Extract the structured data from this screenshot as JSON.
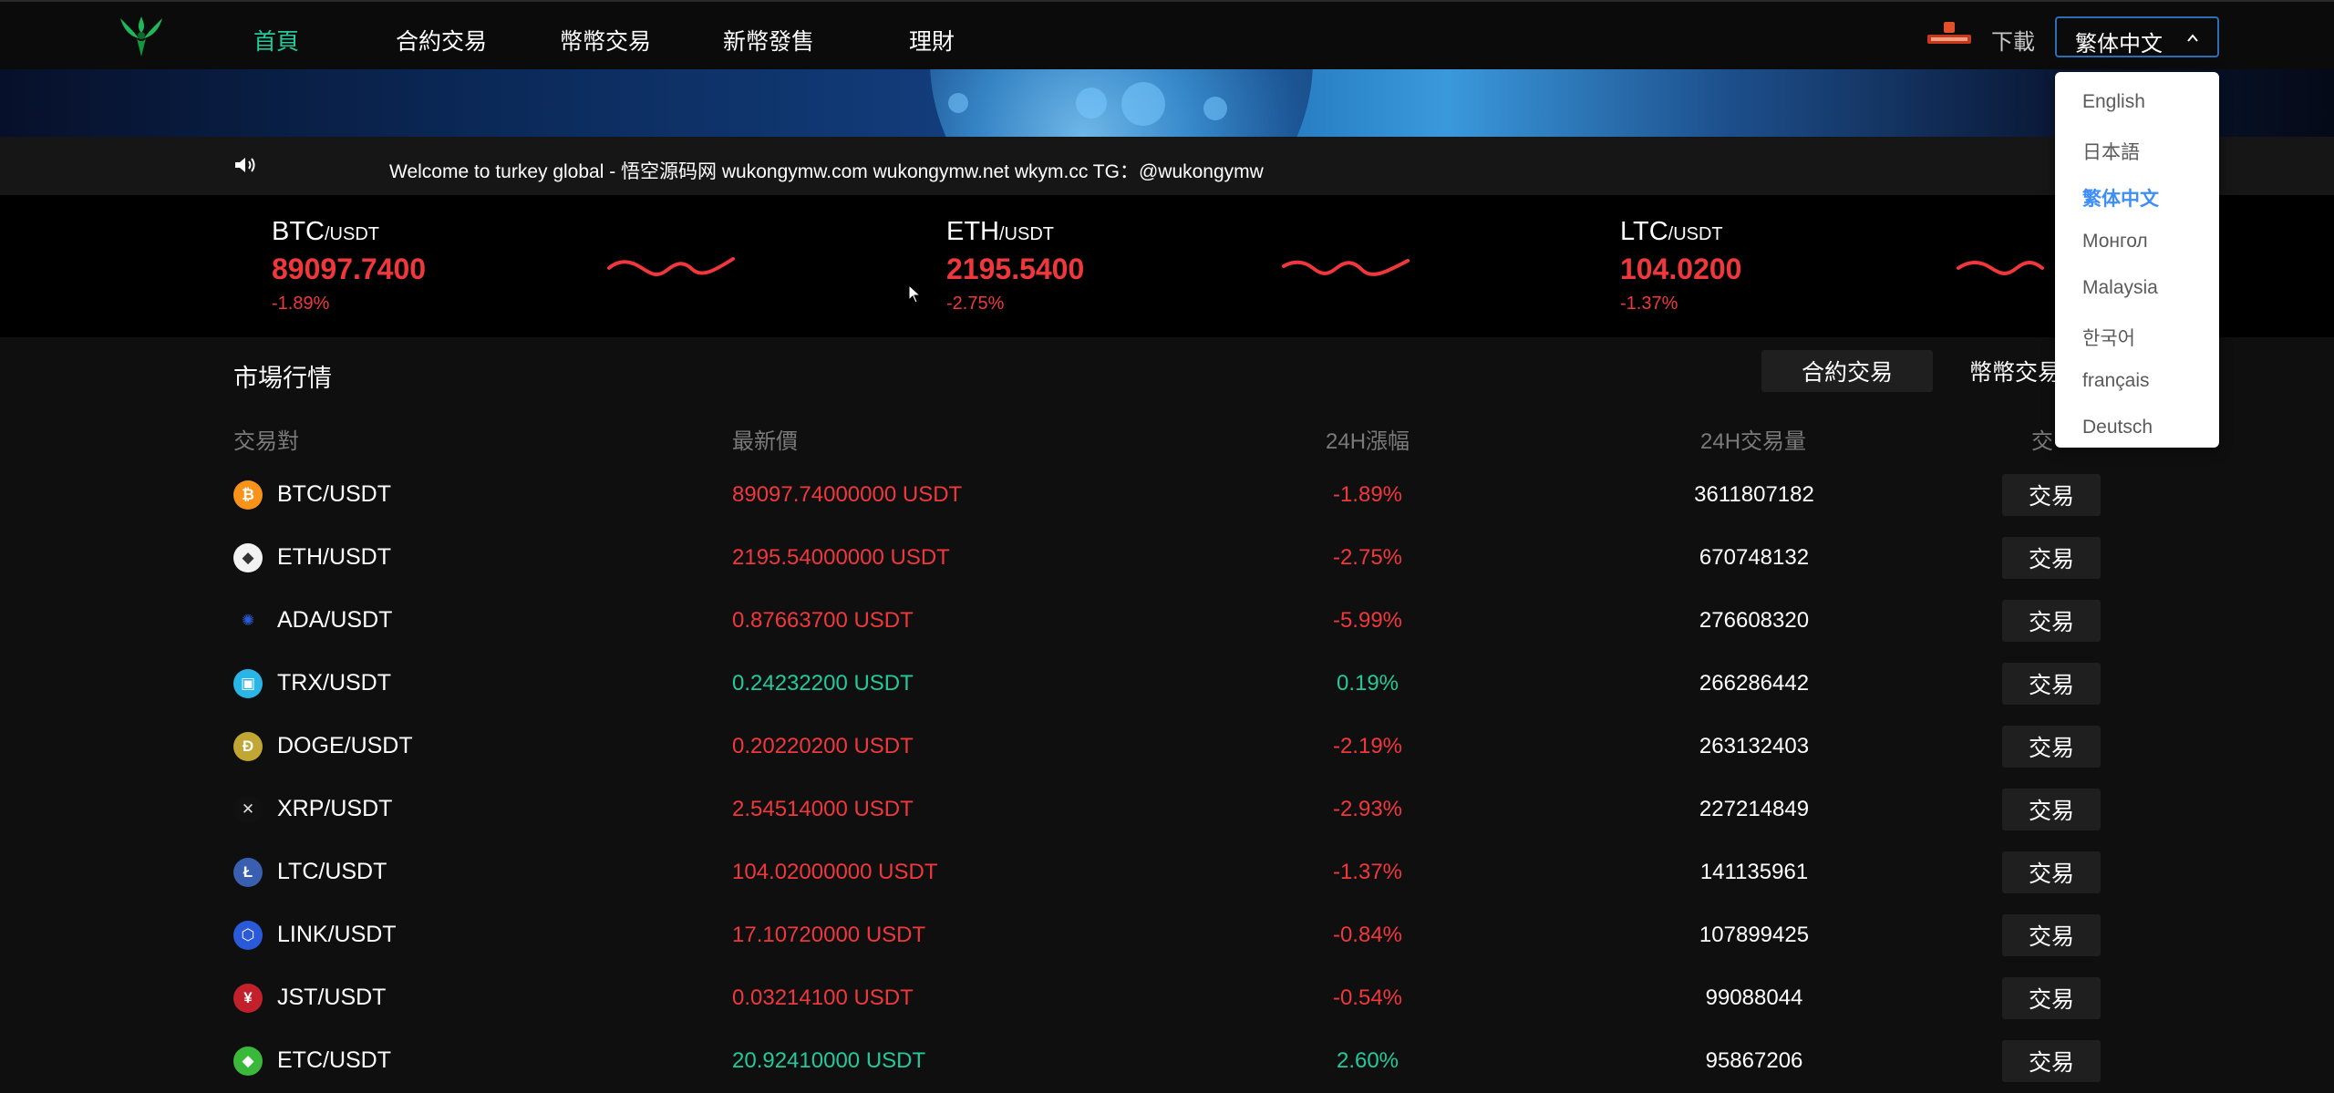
{
  "header": {
    "nav": [
      "首頁",
      "合約交易",
      "幣幣交易",
      "新幣發售",
      "理財"
    ],
    "download_label": "下載",
    "language_value": "繁体中文",
    "icons": {
      "logo": "phoenix-logo",
      "promo": "promo-badge-icon",
      "chevron": "chevron-up-icon"
    },
    "accent_color": "#23c99a"
  },
  "notice": {
    "icon": "speaker-icon",
    "text": "Welcome to turkey global - 悟空源码网 wukongymw.com wukongymw.net wkym.cc TG：@wukongymw"
  },
  "tickers": [
    {
      "base": "BTC",
      "quote": "/USDT",
      "price": "89097.7400",
      "change": "-1.89%"
    },
    {
      "base": "ETH",
      "quote": "/USDT",
      "price": "2195.5400",
      "change": "-2.75%"
    },
    {
      "base": "LTC",
      "quote": "/USDT",
      "price": "104.0200",
      "change": "-1.37%"
    }
  ],
  "market": {
    "title": "市場行情",
    "tabs": [
      "合約交易",
      "幣幣交易"
    ],
    "columns": [
      "交易對",
      "最新價",
      "24H漲幅",
      "24H交易量",
      "交"
    ],
    "trade_label": "交易",
    "rows": [
      {
        "pair": "BTC/USDT",
        "price": "89097.74000000 USDT",
        "change": "-1.89%",
        "volume": "3611807182",
        "dir": "down",
        "icon": "btc-icon"
      },
      {
        "pair": "ETH/USDT",
        "price": "2195.54000000 USDT",
        "change": "-2.75%",
        "volume": "670748132",
        "dir": "down",
        "icon": "eth-icon"
      },
      {
        "pair": "ADA/USDT",
        "price": "0.87663700 USDT",
        "change": "-5.99%",
        "volume": "276608320",
        "dir": "down",
        "icon": "ada-icon"
      },
      {
        "pair": "TRX/USDT",
        "price": "0.24232200 USDT",
        "change": "0.19%",
        "volume": "266286442",
        "dir": "up",
        "icon": "trx-icon"
      },
      {
        "pair": "DOGE/USDT",
        "price": "0.20220200 USDT",
        "change": "-2.19%",
        "volume": "263132403",
        "dir": "down",
        "icon": "doge-icon"
      },
      {
        "pair": "XRP/USDT",
        "price": "2.54514000 USDT",
        "change": "-2.93%",
        "volume": "227214849",
        "dir": "down",
        "icon": "xrp-icon"
      },
      {
        "pair": "LTC/USDT",
        "price": "104.02000000 USDT",
        "change": "-1.37%",
        "volume": "141135961",
        "dir": "down",
        "icon": "ltc-icon"
      },
      {
        "pair": "LINK/USDT",
        "price": "17.10720000 USDT",
        "change": "-0.84%",
        "volume": "107899425",
        "dir": "down",
        "icon": "link-icon"
      },
      {
        "pair": "JST/USDT",
        "price": "0.03214100 USDT",
        "change": "-0.54%",
        "volume": "99088044",
        "dir": "down",
        "icon": "jst-icon"
      },
      {
        "pair": "ETC/USDT",
        "price": "20.92410000 USDT",
        "change": "2.60%",
        "volume": "95867206",
        "dir": "up",
        "icon": "etc-icon"
      }
    ],
    "colors": {
      "up": "#23c99a",
      "down": "#f0383c"
    }
  },
  "language_dropdown": {
    "options": [
      "English",
      "日本語",
      "繁体中文",
      "Монгол",
      "Malaysia",
      "한국어",
      "français",
      "Deutsch"
    ],
    "selected": "繁体中文",
    "selected_color": "#3e8ef7"
  }
}
